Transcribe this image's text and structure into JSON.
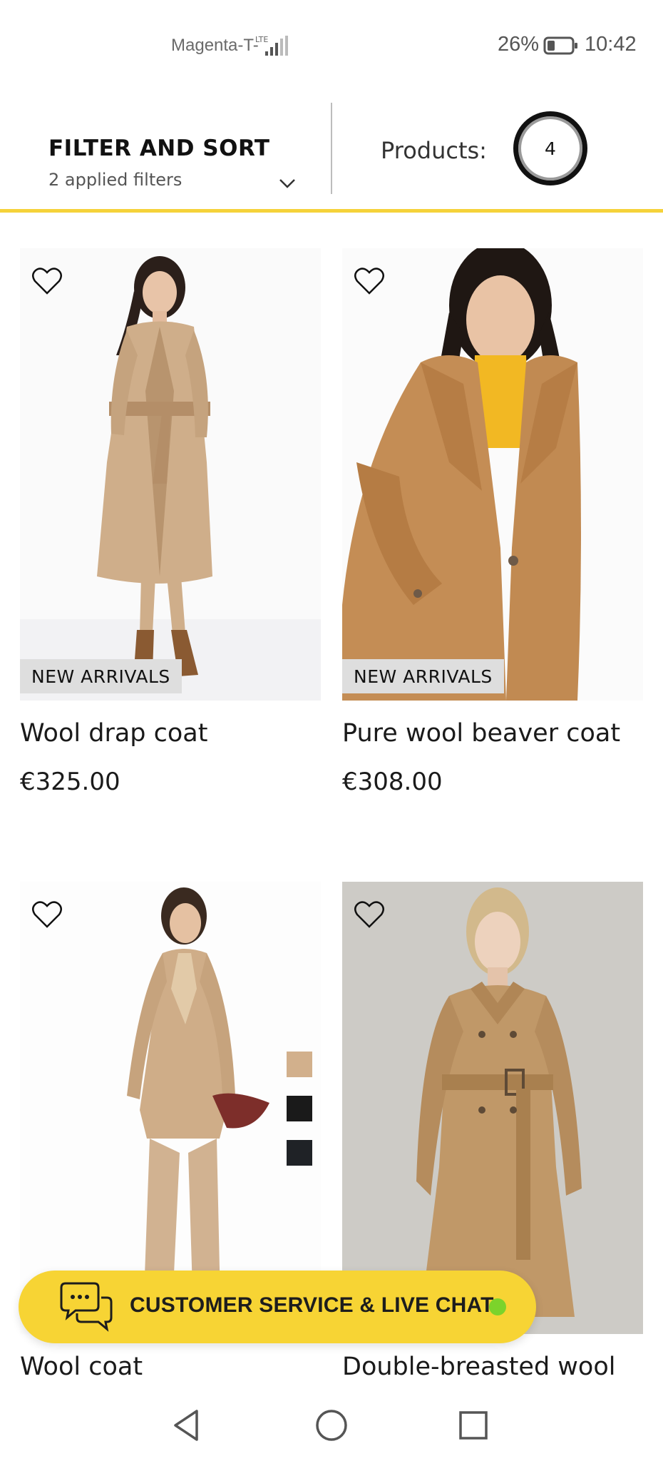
{
  "status_bar": {
    "carrier": "Magenta-T-",
    "network": "LTE",
    "battery": "26%",
    "time": "10:42"
  },
  "filter": {
    "title": "FILTER AND SORT",
    "applied": "2 applied filters",
    "products_label": "Products:",
    "products_count": "4"
  },
  "products": [
    {
      "name": "Wool drap coat",
      "price": "€325.00",
      "badge": "NEW ARRIVALS"
    },
    {
      "name": "Pure wool beaver coat",
      "price": "€308.00",
      "badge": "NEW ARRIVALS"
    },
    {
      "name": "Wool coat",
      "swatches": [
        "#d2b08c",
        "#1a1a1a",
        "#1f2226"
      ]
    },
    {
      "name": "Double-breasted wool"
    }
  ],
  "chat": {
    "label": "CUSTOMER SERVICE & LIVE CHAT",
    "status_color": "#7cd32b"
  },
  "colors": {
    "accent_yellow": "#f5d23a",
    "camel": "#c49a6c",
    "badge_bg": "#dedede"
  }
}
